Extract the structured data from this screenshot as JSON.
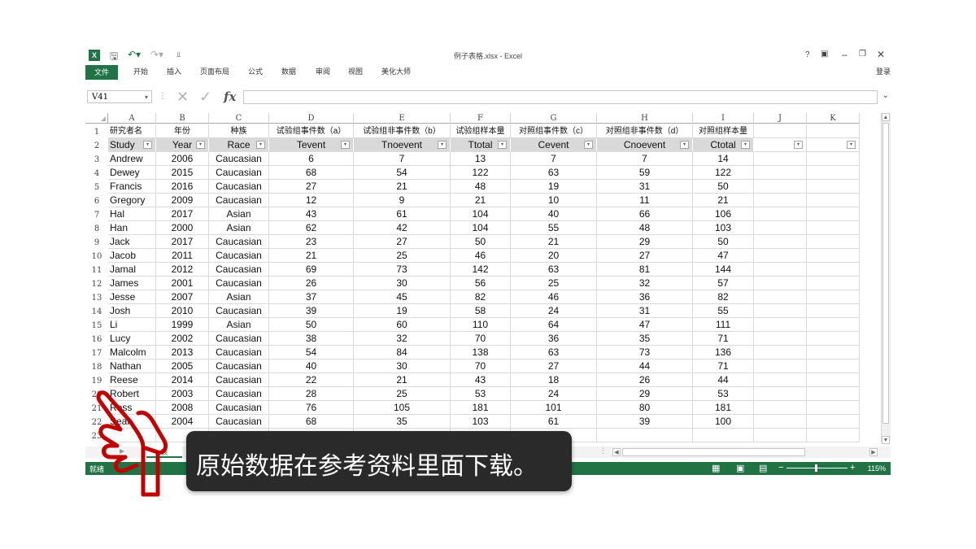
{
  "window": {
    "title": "例子表格.xlsx - Excel",
    "help": "?",
    "login": "登录"
  },
  "ribbon": {
    "tabs": [
      "文件",
      "开始",
      "插入",
      "页面布局",
      "公式",
      "数据",
      "审阅",
      "视图",
      "美化大师"
    ]
  },
  "formula_bar": {
    "name_box": "V41",
    "formula": ""
  },
  "columns": [
    "A",
    "B",
    "C",
    "D",
    "E",
    "F",
    "G",
    "H",
    "I",
    "J",
    "K"
  ],
  "row_numbers": [
    "1",
    "2",
    "3",
    "4",
    "5",
    "6",
    "7",
    "8",
    "9",
    "10",
    "11",
    "12",
    "13",
    "14",
    "15",
    "16",
    "17",
    "18",
    "19",
    "20",
    "21",
    "22",
    "23"
  ],
  "chinese_headers": [
    "研究者名",
    "年份",
    "种族",
    "试验组事件数（a）",
    "试验组非事件数（b）",
    "试验组样本量",
    "对照组事件数（c）",
    "对照组非事件数（d）",
    "对照组样本量"
  ],
  "table_headers": [
    "Study",
    "Year",
    "Race",
    "Tevent",
    "Tnoevent",
    "Ttotal",
    "Cevent",
    "Cnoevent",
    "Ctotal"
  ],
  "rows": [
    [
      "Andrew",
      "2006",
      "Caucasian",
      "6",
      "7",
      "13",
      "7",
      "7",
      "14"
    ],
    [
      "Dewey",
      "2015",
      "Caucasian",
      "68",
      "54",
      "122",
      "63",
      "59",
      "122"
    ],
    [
      "Francis",
      "2016",
      "Caucasian",
      "27",
      "21",
      "48",
      "19",
      "31",
      "50"
    ],
    [
      "Gregory",
      "2009",
      "Caucasian",
      "12",
      "9",
      "21",
      "10",
      "11",
      "21"
    ],
    [
      "Hal",
      "2017",
      "Asian",
      "43",
      "61",
      "104",
      "40",
      "66",
      "106"
    ],
    [
      "Han",
      "2000",
      "Asian",
      "62",
      "42",
      "104",
      "55",
      "48",
      "103"
    ],
    [
      "Jack",
      "2017",
      "Caucasian",
      "23",
      "27",
      "50",
      "21",
      "29",
      "50"
    ],
    [
      "Jacob",
      "2011",
      "Caucasian",
      "21",
      "25",
      "46",
      "20",
      "27",
      "47"
    ],
    [
      "Jamal",
      "2012",
      "Caucasian",
      "69",
      "73",
      "142",
      "63",
      "81",
      "144"
    ],
    [
      "James",
      "2001",
      "Caucasian",
      "26",
      "30",
      "56",
      "25",
      "32",
      "57"
    ],
    [
      "Jesse",
      "2007",
      "Asian",
      "37",
      "45",
      "82",
      "46",
      "36",
      "82"
    ],
    [
      "Josh",
      "2010",
      "Caucasian",
      "39",
      "19",
      "58",
      "24",
      "31",
      "55"
    ],
    [
      "Li",
      "1999",
      "Asian",
      "50",
      "60",
      "110",
      "64",
      "47",
      "111"
    ],
    [
      "Lucy",
      "2002",
      "Caucasian",
      "38",
      "32",
      "70",
      "36",
      "35",
      "71"
    ],
    [
      "Malcolm",
      "2013",
      "Caucasian",
      "54",
      "84",
      "138",
      "63",
      "73",
      "136"
    ],
    [
      "Nathan",
      "2005",
      "Caucasian",
      "40",
      "30",
      "70",
      "27",
      "44",
      "71"
    ],
    [
      "Reese",
      "2014",
      "Caucasian",
      "22",
      "21",
      "43",
      "18",
      "26",
      "44"
    ],
    [
      "Robert",
      "2003",
      "Caucasian",
      "28",
      "25",
      "53",
      "24",
      "29",
      "53"
    ],
    [
      "Ross",
      "2008",
      "Caucasian",
      "76",
      "105",
      "181",
      "101",
      "80",
      "181"
    ],
    [
      "Sean",
      "2004",
      "Caucasian",
      "68",
      "35",
      "103",
      "61",
      "39",
      "100"
    ]
  ],
  "sheet_tab": "表",
  "status": {
    "ready": "就绪",
    "zoom": "115%"
  },
  "caption": "原始数据在参考资料里面下载。",
  "colors": {
    "excel_green": "#217346",
    "header_gray": "#d9d9d9",
    "caption_bg": "#2a2a2a",
    "hand_red": "#c00000"
  }
}
